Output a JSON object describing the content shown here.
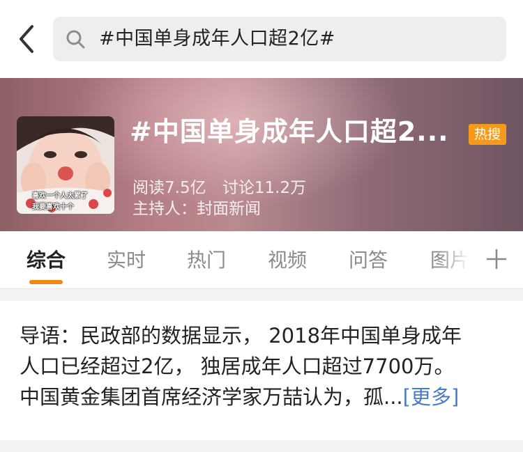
{
  "search": {
    "query": "#中国单身成年人口超2亿#"
  },
  "hero": {
    "title": "#中国单身成年人口超2...",
    "badge": "热搜",
    "reads": "阅读7.5亿",
    "discussions": "讨论11.2万",
    "host": "主持人：封面新闻",
    "thumbnail_caption_line1": "喜欢一个人太累了",
    "thumbnail_caption_line2": "我要喜欢十个"
  },
  "tabs": [
    {
      "label": "综合",
      "active": true
    },
    {
      "label": "实时"
    },
    {
      "label": "热门"
    },
    {
      "label": "视频"
    },
    {
      "label": "问答"
    },
    {
      "label": "图片"
    }
  ],
  "intro": {
    "line1": "导语：民政部的数据显示， 2018年中国单身成年",
    "line2": "人口已经超过2亿， 独居成年人口超过7700万。",
    "line3": "中国黄金集团首席经济学家万喆认为，孤...",
    "more": "[更多]"
  },
  "colors": {
    "accent": "#f08a10",
    "badge": "#f59a1b",
    "link": "#4a7bc4"
  },
  "icons": [
    "back-arrow-icon",
    "search-icon",
    "plus-icon"
  ]
}
